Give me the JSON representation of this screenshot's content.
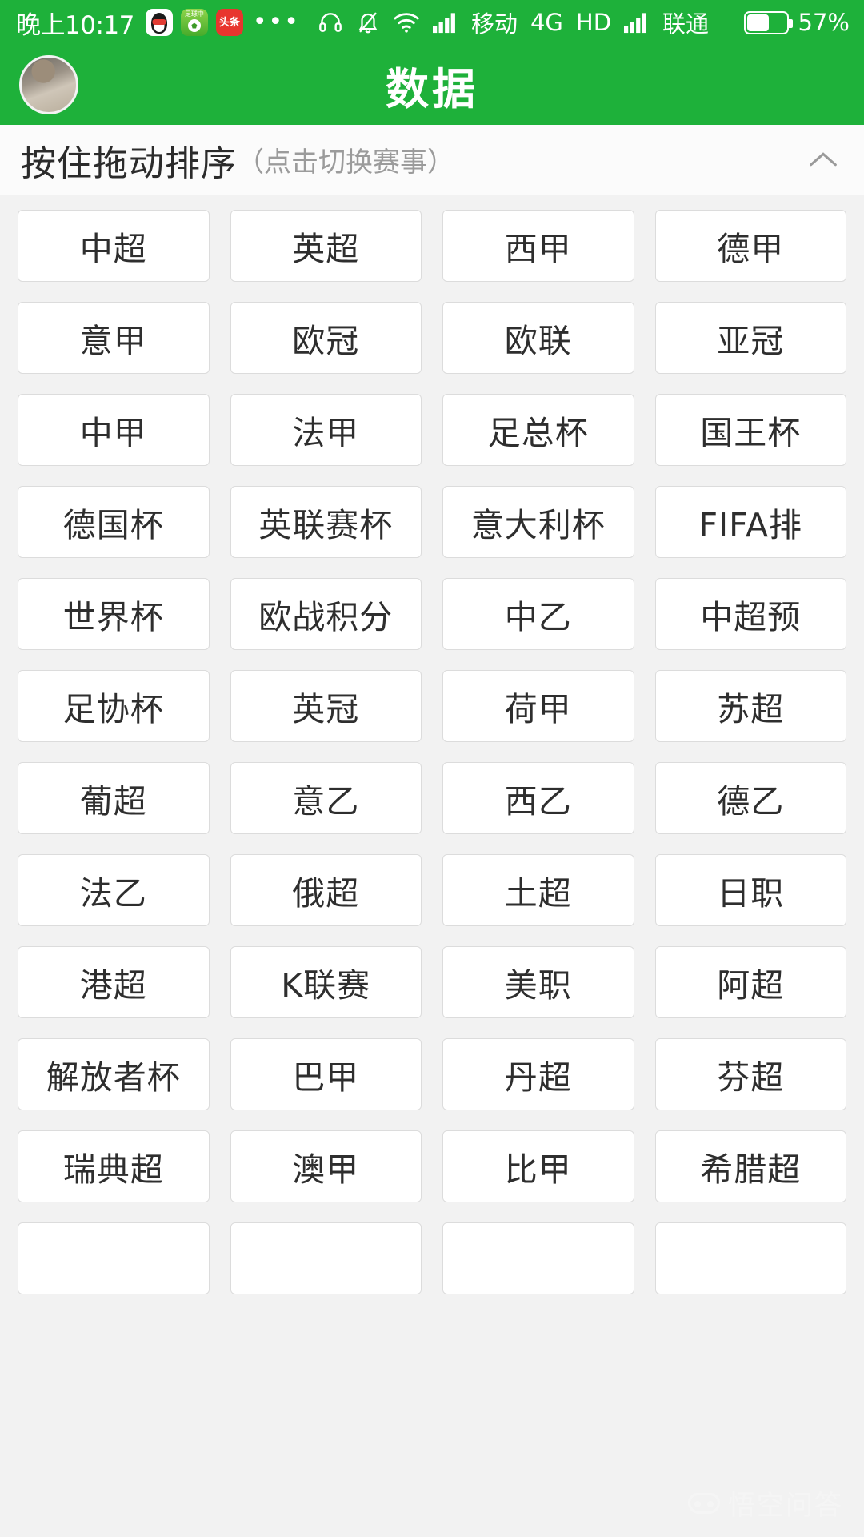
{
  "statusbar": {
    "time": "晚上10:17",
    "app_icons": [
      {
        "name": "qq-icon",
        "label": "QQ"
      },
      {
        "name": "football-app-icon",
        "label": "足球中"
      },
      {
        "name": "toutiao-icon",
        "label": "头条"
      }
    ],
    "overflow_dots": "•••",
    "icons": [
      "headset-icon",
      "bell-muted-icon",
      "wifi-icon",
      "signal-icon"
    ],
    "carrier1": "移动",
    "network": "4G",
    "hd": "HD",
    "carrier2": "联通",
    "battery_percent": "57%",
    "battery_level": 57,
    "background_color": "#1eb13a"
  },
  "titlebar": {
    "title": "数据",
    "avatar_name": "user-avatar",
    "background_color": "#1eb13a"
  },
  "section_header": {
    "main_text": "按住拖动排序",
    "sub_text": "（点击切换赛事）",
    "collapse_icon": "chevron-up-icon"
  },
  "grid": {
    "columns": 4,
    "items": [
      "中超",
      "英超",
      "西甲",
      "德甲",
      "意甲",
      "欧冠",
      "欧联",
      "亚冠",
      "中甲",
      "法甲",
      "足总杯",
      "国王杯",
      "德国杯",
      "英联赛杯",
      "意大利杯",
      "FIFA排",
      "世界杯",
      "欧战积分",
      "中乙",
      "中超预",
      "足协杯",
      "英冠",
      "荷甲",
      "苏超",
      "葡超",
      "意乙",
      "西乙",
      "德乙",
      "法乙",
      "俄超",
      "土超",
      "日职",
      "港超",
      "K联赛",
      "美职",
      "阿超",
      "解放者杯",
      "巴甲",
      "丹超",
      "芬超",
      "瑞典超",
      "澳甲",
      "比甲",
      "希腊超",
      "",
      "",
      "",
      ""
    ]
  },
  "watermark": {
    "text": "悟空问答"
  },
  "colors": {
    "brand_green": "#1eb13a",
    "page_background": "#f2f2f2",
    "cell_background": "#ffffff",
    "cell_border": "#dcdcdc",
    "text_primary": "#2e2e2e",
    "text_muted": "#9b9b9b"
  }
}
